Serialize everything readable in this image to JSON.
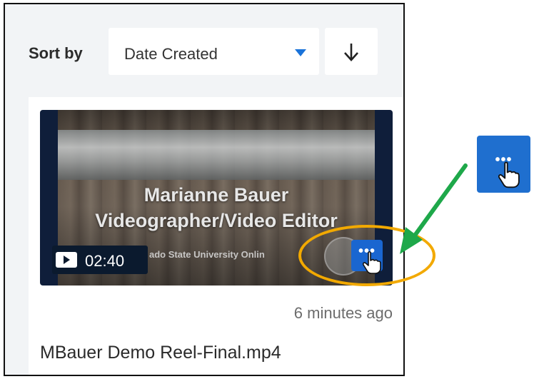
{
  "sort": {
    "label": "Sort by",
    "selected": "Date Created",
    "direction_icon": "arrow-down-icon"
  },
  "video_card": {
    "thumbnail": {
      "title_line1": "Marianne Bauer",
      "title_line2": "Videographer/Video Editor",
      "watermark": "ado State University Onlin"
    },
    "duration": "02:40",
    "more_button_icon": "ellipsis-icon",
    "timestamp": "6 minutes ago",
    "filename": "MBauer Demo Reel-Final.mp4"
  },
  "annotations": {
    "highlight_color": "#f2a900",
    "arrow_color": "#1ea84a",
    "inset_icon": "ellipsis-icon"
  },
  "colors": {
    "accent": "#1a66d0",
    "badge_bg": "#0b1a2e",
    "panel_bg": "#f2f4f6"
  }
}
